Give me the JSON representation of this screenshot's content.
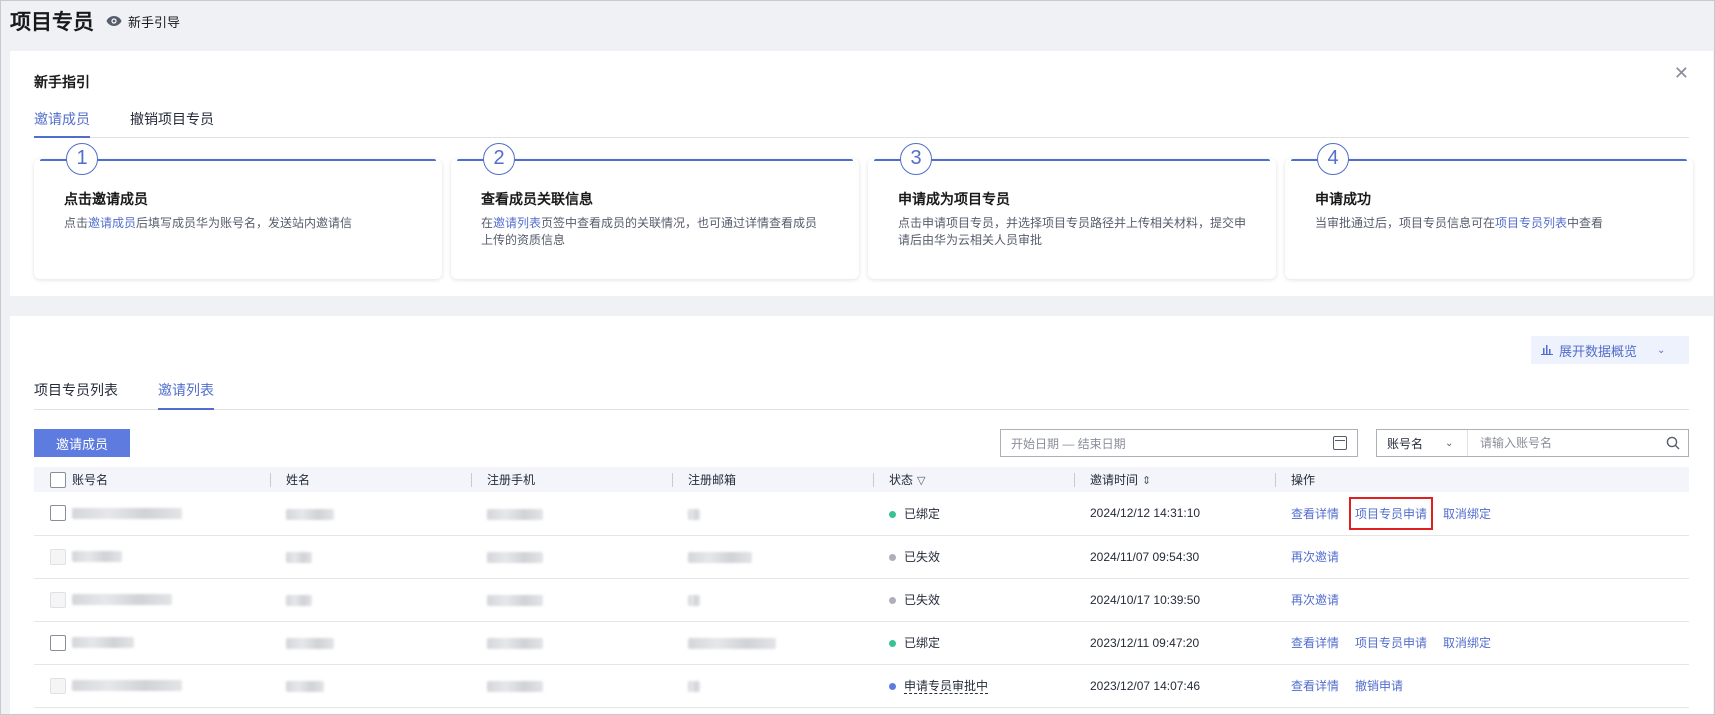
{
  "header": {
    "title": "项目专员",
    "guide_label": "新手引导"
  },
  "guide": {
    "heading": "新手指引",
    "tabs": [
      {
        "label": "邀请成员",
        "active": true
      },
      {
        "label": "撤销项目专员",
        "active": false
      }
    ],
    "steps": [
      {
        "num": "1",
        "title": "点击邀请成员",
        "pre": "点击",
        "link": "邀请成员",
        "post": "后填写成员华为账号名，发送站内邀请信"
      },
      {
        "num": "2",
        "title": "查看成员关联信息",
        "pre": "在",
        "link": "邀请列表",
        "post": "页签中查看成员的关联情况，也可通过详情查看成员上传的资质信息"
      },
      {
        "num": "3",
        "title": "申请成为项目专员",
        "pre": "点击申请项目专员，并选择项目专员路径并上传相关材料，提交申请后由华为云相关人员审批",
        "link": "",
        "post": ""
      },
      {
        "num": "4",
        "title": "申请成功",
        "pre": "当审批通过后，项目专员信息可在",
        "link": "项目专员列表",
        "post": "中查看"
      }
    ]
  },
  "list": {
    "overview_label": "展开数据概览",
    "tabs": [
      {
        "label": "项目专员列表",
        "active": false
      },
      {
        "label": "邀请列表",
        "active": true
      }
    ],
    "invite_button": "邀请成员",
    "date_placeholder": "开始日期 — 结束日期",
    "search_field": "账号名",
    "search_placeholder": "请输入账号名",
    "columns": [
      "账号名",
      "姓名",
      "注册手机",
      "注册邮箱",
      "状态",
      "邀请时间",
      "操作"
    ],
    "rows": [
      {
        "status": "已绑定",
        "status_color": "#3ac295",
        "time": "2024/12/12 14:31:10",
        "actions": [
          "查看详情",
          "项目专员申请",
          "取消绑定"
        ],
        "checkbox_enabled": true,
        "highlight_action": 1
      },
      {
        "status": "已失效",
        "status_color": "#adb0b8",
        "time": "2024/11/07 09:54:30",
        "actions": [
          "再次邀请"
        ],
        "checkbox_enabled": false,
        "highlight_action": -1
      },
      {
        "status": "已失效",
        "status_color": "#adb0b8",
        "time": "2024/10/17 10:39:50",
        "actions": [
          "再次邀请"
        ],
        "checkbox_enabled": false,
        "highlight_action": -1
      },
      {
        "status": "已绑定",
        "status_color": "#3ac295",
        "time": "2023/12/11 09:47:20",
        "actions": [
          "查看详情",
          "项目专员申请",
          "取消绑定"
        ],
        "checkbox_enabled": true,
        "highlight_action": -1
      },
      {
        "status": "申请专员审批中",
        "status_color": "#5e7ce0",
        "time": "2023/12/07 14:07:46",
        "actions": [
          "查看详情",
          "撤销申请"
        ],
        "checkbox_enabled": false,
        "highlight_action": -1
      }
    ]
  }
}
